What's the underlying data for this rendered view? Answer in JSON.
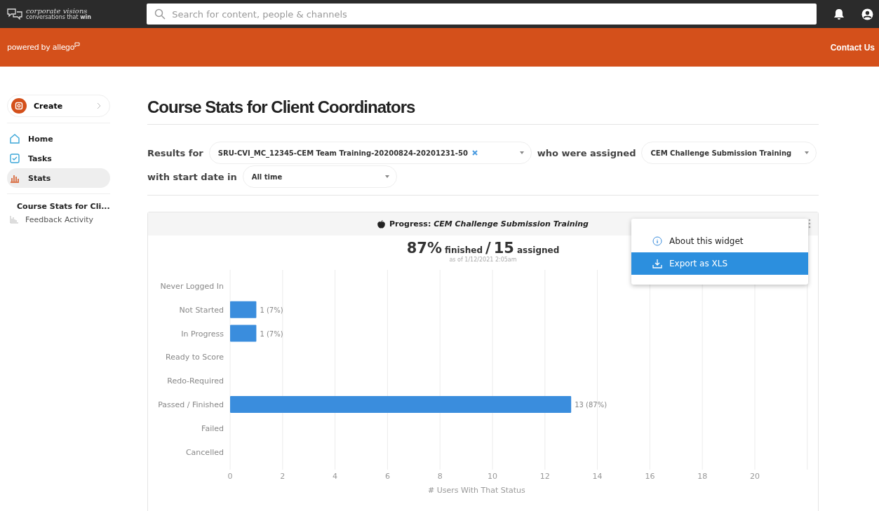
{
  "topbar": {
    "logo": {
      "name": "corporate visions",
      "tagline": "conversations that **win**"
    },
    "search": {
      "placeholder": "Search for content, people & channels"
    }
  },
  "brandbar": {
    "powered_by": "powered by allego",
    "contact": "Contact Us"
  },
  "sidebar": {
    "create": "Create",
    "nav": [
      {
        "label": "Home",
        "kind": "home",
        "selected": false
      },
      {
        "label": "Tasks",
        "kind": "tasks",
        "selected": false
      },
      {
        "label": "Stats",
        "kind": "stats",
        "selected": true
      }
    ],
    "reports": [
      {
        "label": "Course Stats for Cli...",
        "selected": true
      },
      {
        "label": "Feedback Activity",
        "selected": false
      }
    ]
  },
  "page": {
    "title": "Course Stats for Client Coordinators"
  },
  "filters": {
    "results_for": "Results for",
    "group": "SRU-CVI_MC_12345-CEM Team Training-20200824-20201231-50",
    "who_assigned": "who were assigned",
    "course": "CEM Challenge Submission Training",
    "start_date_label": "with start date in",
    "start_date": "All time"
  },
  "widget": {
    "title_prefix": "Progress:",
    "title_course": "CEM Challenge Submission Training",
    "finished_pct": "87%",
    "finished_label": "finished",
    "slash": "/",
    "assigned_count": "15",
    "assigned_label": "assigned",
    "as_of": "as of 1/12/2021 2:05am",
    "menu": [
      {
        "label": "About this widget",
        "kind": "info",
        "selected": false
      },
      {
        "label": "Export as XLS",
        "kind": "download",
        "selected": true
      }
    ],
    "chart_data": {
      "type": "bar",
      "orientation": "horizontal",
      "xlabel": "# Users With That Status",
      "categories": [
        "Never Logged In",
        "Not Started",
        "In Progress",
        "Ready to Score",
        "Redo-Required",
        "Passed / Finished",
        "Failed",
        "Cancelled"
      ],
      "series": [
        {
          "color": "#3a8ddd",
          "values": [
            0,
            1,
            1,
            0,
            0,
            13,
            0,
            0
          ]
        }
      ],
      "grid": true,
      "value_labels": [
        null,
        "1 (7%)",
        "1 (7%)",
        null,
        null,
        "13 (87%)",
        null,
        null
      ],
      "xlim": [
        0,
        22
      ],
      "xticks": [
        0,
        2,
        4,
        6,
        8,
        10,
        12,
        14,
        16,
        18,
        20
      ]
    }
  }
}
